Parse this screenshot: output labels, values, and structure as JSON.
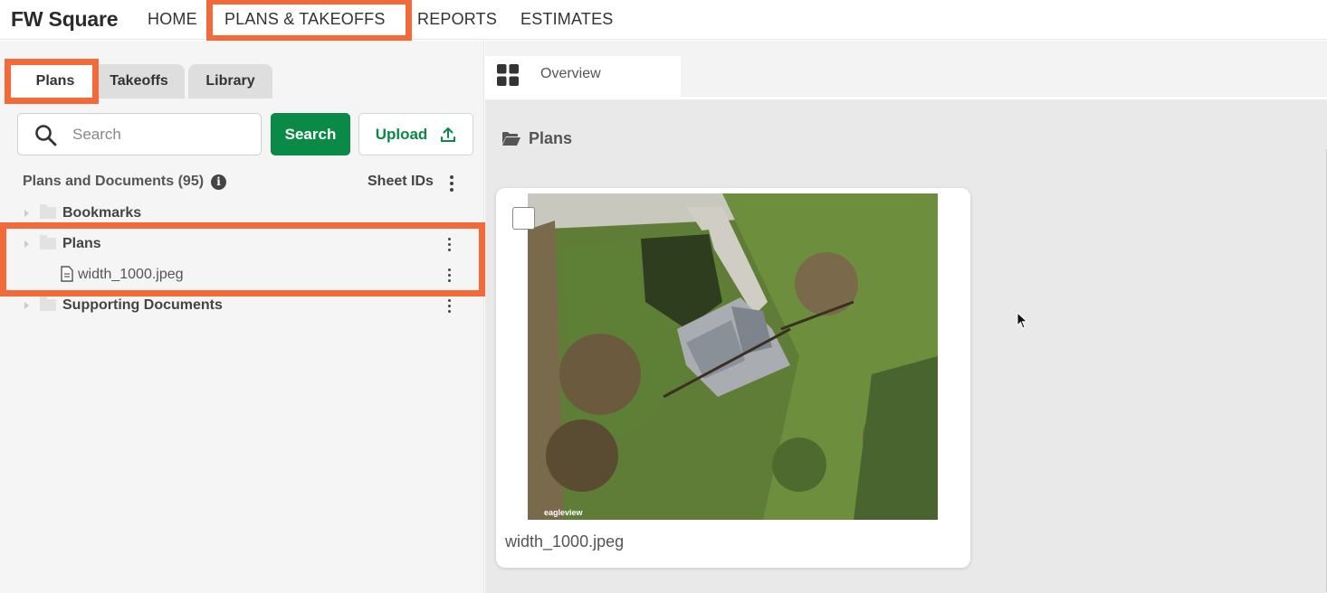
{
  "brand": "FW Square",
  "nav": {
    "home": "HOME",
    "plans_takeoffs": "PLANS & TAKEOFFS",
    "reports": "REPORTS",
    "estimates": "ESTIMATES"
  },
  "left_tabs": {
    "plans": "Plans",
    "takeoffs": "Takeoffs",
    "library": "Library"
  },
  "search": {
    "placeholder": "Search",
    "value": "",
    "button_label": "Search",
    "upload_label": "Upload"
  },
  "docs": {
    "header": "Plans and Documents (95)",
    "info_glyph": "i",
    "sheet_ids": "Sheet IDs"
  },
  "tree": {
    "bookmarks": "Bookmarks",
    "plans": "Plans",
    "plan_file": "width_1000.jpeg",
    "supporting": "Supporting Documents"
  },
  "overview": {
    "tab_label": "Overview",
    "heading": "Plans"
  },
  "card": {
    "title": "width_1000.jpeg",
    "watermark": "eagleview"
  },
  "colors": {
    "accent_green": "#0a8a46",
    "highlight_orange": "#f26a3a"
  }
}
